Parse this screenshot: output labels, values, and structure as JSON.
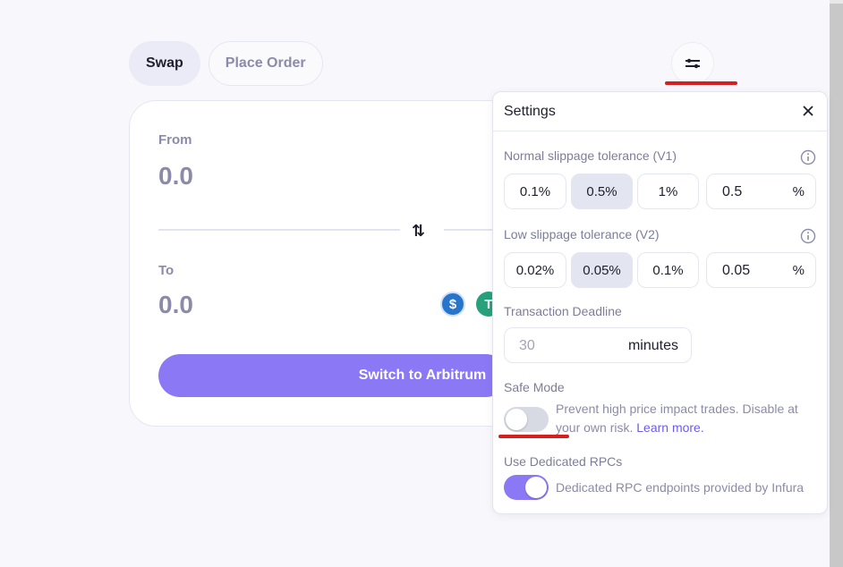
{
  "tabs": [
    {
      "label": "Swap",
      "active": true
    },
    {
      "label": "Place Order",
      "active": false
    }
  ],
  "swap": {
    "from_label": "From",
    "from_amount": "0.0",
    "to_label": "To",
    "to_amount": "0.0",
    "coins": [
      {
        "icon": "usdc-coin-icon",
        "color": "#2775ca"
      },
      {
        "icon": "usdt-coin-icon",
        "color": "#26a17b"
      }
    ],
    "action_label": "Switch to Arbitrum"
  },
  "settings": {
    "title": "Settings",
    "normal_slippage": {
      "label": "Normal slippage tolerance (V1)",
      "options": [
        "0.1%",
        "0.5%",
        "1%"
      ],
      "selected": "0.5%",
      "custom_value": "0.5",
      "unit": "%"
    },
    "low_slippage": {
      "label": "Low slippage tolerance (V2)",
      "options": [
        "0.02%",
        "0.05%",
        "0.1%"
      ],
      "selected": "0.05%",
      "custom_value": "0.05",
      "unit": "%"
    },
    "deadline": {
      "label": "Transaction Deadline",
      "placeholder": "30",
      "unit": "minutes"
    },
    "safe_mode": {
      "label": "Safe Mode",
      "enabled": false,
      "description": "Prevent high price impact trades. Disable at your own risk.",
      "link": "Learn more."
    },
    "dedicated_rpcs": {
      "label": "Use Dedicated RPCs",
      "enabled": true,
      "description": "Dedicated RPC endpoints provided by Infura"
    }
  },
  "colors": {
    "accent": "#8b78f5",
    "annotation": "#d42020"
  }
}
